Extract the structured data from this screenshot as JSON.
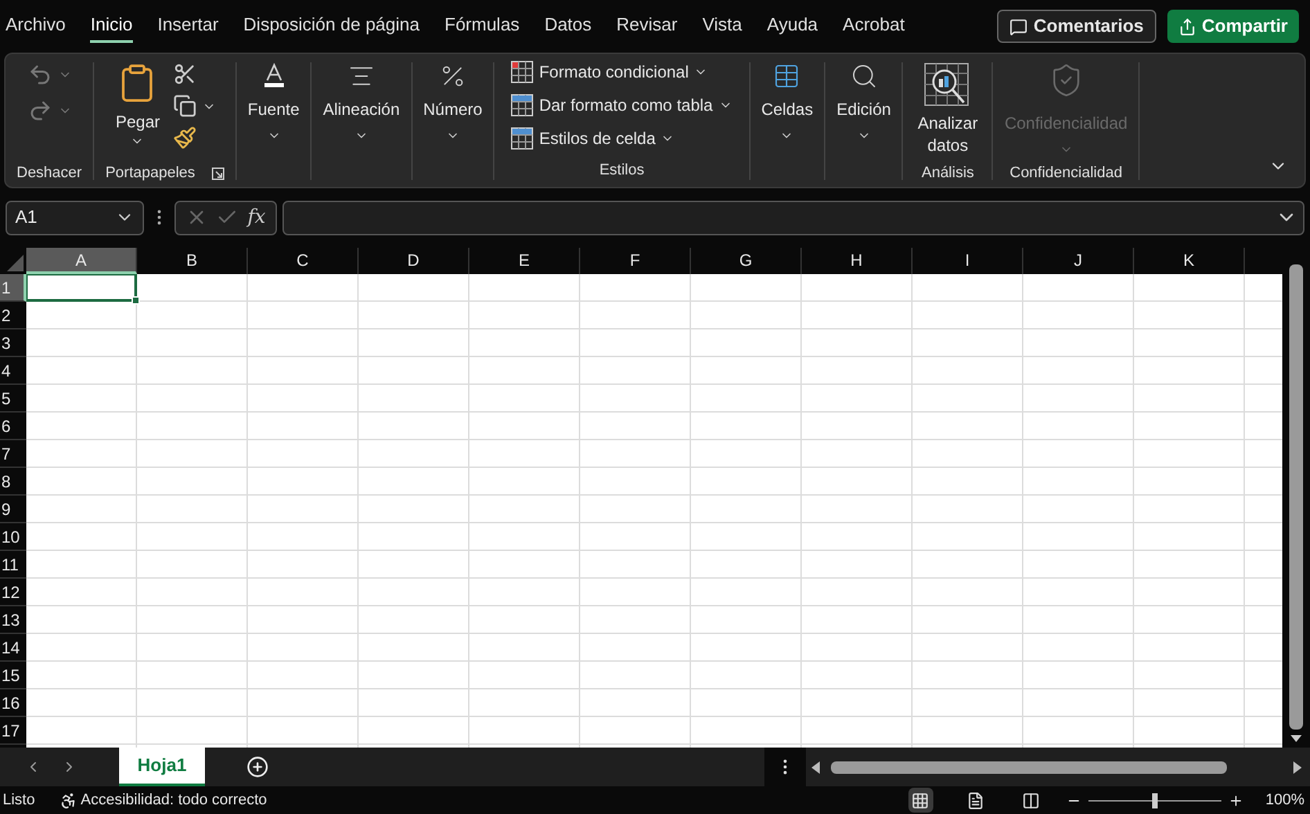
{
  "menu_tabs": [
    {
      "label": "Archivo",
      "selected": false
    },
    {
      "label": "Inicio",
      "selected": true
    },
    {
      "label": "Insertar",
      "selected": false
    },
    {
      "label": "Disposición de página",
      "selected": false
    },
    {
      "label": "Fórmulas",
      "selected": false
    },
    {
      "label": "Datos",
      "selected": false
    },
    {
      "label": "Revisar",
      "selected": false
    },
    {
      "label": "Vista",
      "selected": false
    },
    {
      "label": "Ayuda",
      "selected": false
    },
    {
      "label": "Acrobat",
      "selected": false
    }
  ],
  "header_buttons": [
    {
      "label": "Comentarios",
      "kind": "outline"
    },
    {
      "label": "Compartir",
      "kind": "primary"
    }
  ],
  "ribbon": {
    "groups": [
      {
        "kind": "undo",
        "label": "Deshacer"
      },
      {
        "kind": "clipboard",
        "label": "Portapapeles",
        "button": "Pegar"
      },
      {
        "kind": "dropdown",
        "button": "Fuente",
        "disabled": false
      },
      {
        "kind": "dropdown",
        "button": "Alineación",
        "disabled": false
      },
      {
        "kind": "dropdown",
        "button": "Número",
        "disabled": false
      },
      {
        "kind": "styles",
        "label": "Estilos",
        "items": [
          "Formato condicional",
          "Dar formato como tabla",
          "Estilos de celda"
        ]
      },
      {
        "kind": "dropdown",
        "button": "Celdas",
        "disabled": false
      },
      {
        "kind": "dropdown",
        "button": "Edición",
        "disabled": false
      },
      {
        "kind": "analysis",
        "label": "Análisis",
        "button": "Analizar datos"
      },
      {
        "kind": "dropdown",
        "label": "Confidencialidad",
        "button": "Confidencialidad",
        "disabled": true
      }
    ]
  },
  "formula_bar": {
    "name_box": "A1",
    "function_button": "fx"
  },
  "sheet": {
    "columns": [
      {
        "label": "A",
        "selected": true
      },
      {
        "label": "B",
        "selected": false
      },
      {
        "label": "C",
        "selected": false
      },
      {
        "label": "D",
        "selected": false
      },
      {
        "label": "E",
        "selected": false
      },
      {
        "label": "F",
        "selected": false
      },
      {
        "label": "G",
        "selected": false
      },
      {
        "label": "H",
        "selected": false
      },
      {
        "label": "I",
        "selected": false
      },
      {
        "label": "J",
        "selected": false
      },
      {
        "label": "K",
        "selected": false
      }
    ],
    "rows": [
      {
        "label": "1",
        "selected": true
      },
      {
        "label": "2",
        "selected": false
      },
      {
        "label": "3",
        "selected": false
      },
      {
        "label": "4",
        "selected": false
      },
      {
        "label": "5",
        "selected": false
      },
      {
        "label": "6",
        "selected": false
      },
      {
        "label": "7",
        "selected": false
      },
      {
        "label": "8",
        "selected": false
      },
      {
        "label": "9",
        "selected": false
      },
      {
        "label": "10",
        "selected": false
      },
      {
        "label": "11",
        "selected": false
      },
      {
        "label": "12",
        "selected": false
      },
      {
        "label": "13",
        "selected": false
      },
      {
        "label": "14",
        "selected": false
      },
      {
        "label": "15",
        "selected": false
      },
      {
        "label": "16",
        "selected": false
      },
      {
        "label": "17",
        "selected": false
      }
    ]
  },
  "sheet_tabs": [
    {
      "label": "Hoja1",
      "selected": true
    }
  ],
  "status_bar": {
    "status": "Listo",
    "accessibility": "Accesibilidad: todo correcto",
    "views": [
      {
        "kind": "normal",
        "selected": true
      },
      {
        "kind": "layout",
        "selected": false
      },
      {
        "kind": "break",
        "selected": false
      }
    ],
    "zoom": {
      "level": 0.5,
      "reading": "100%"
    }
  }
}
